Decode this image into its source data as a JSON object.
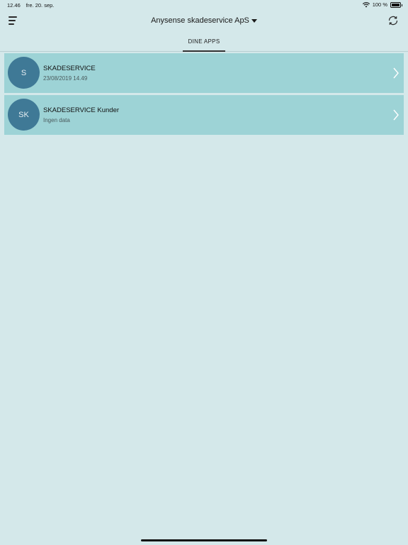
{
  "status_bar": {
    "time": "12.46",
    "date": "fre. 20. sep.",
    "battery": "100 %",
    "battery_level": 1.0,
    "wifi_icon": "wifi-icon"
  },
  "header": {
    "menu_icon": "hamburger-menu-icon",
    "title": "Anysense skadeservice ApS",
    "dropdown_icon": "caret-down-icon",
    "sync_icon": "sync-icon"
  },
  "tabs": [
    {
      "label": "DINE APPS",
      "active": true
    }
  ],
  "apps": [
    {
      "initials": "S",
      "name": "SKADESERVICE",
      "subtitle": "23/08/2019 14.49"
    },
    {
      "initials": "SK",
      "name": "SKADESERVICE Kunder",
      "subtitle": "Ingen data"
    }
  ],
  "colors": {
    "background": "#d4e8ea",
    "row_background": "#9dd3d6",
    "avatar": "#3f7996"
  }
}
